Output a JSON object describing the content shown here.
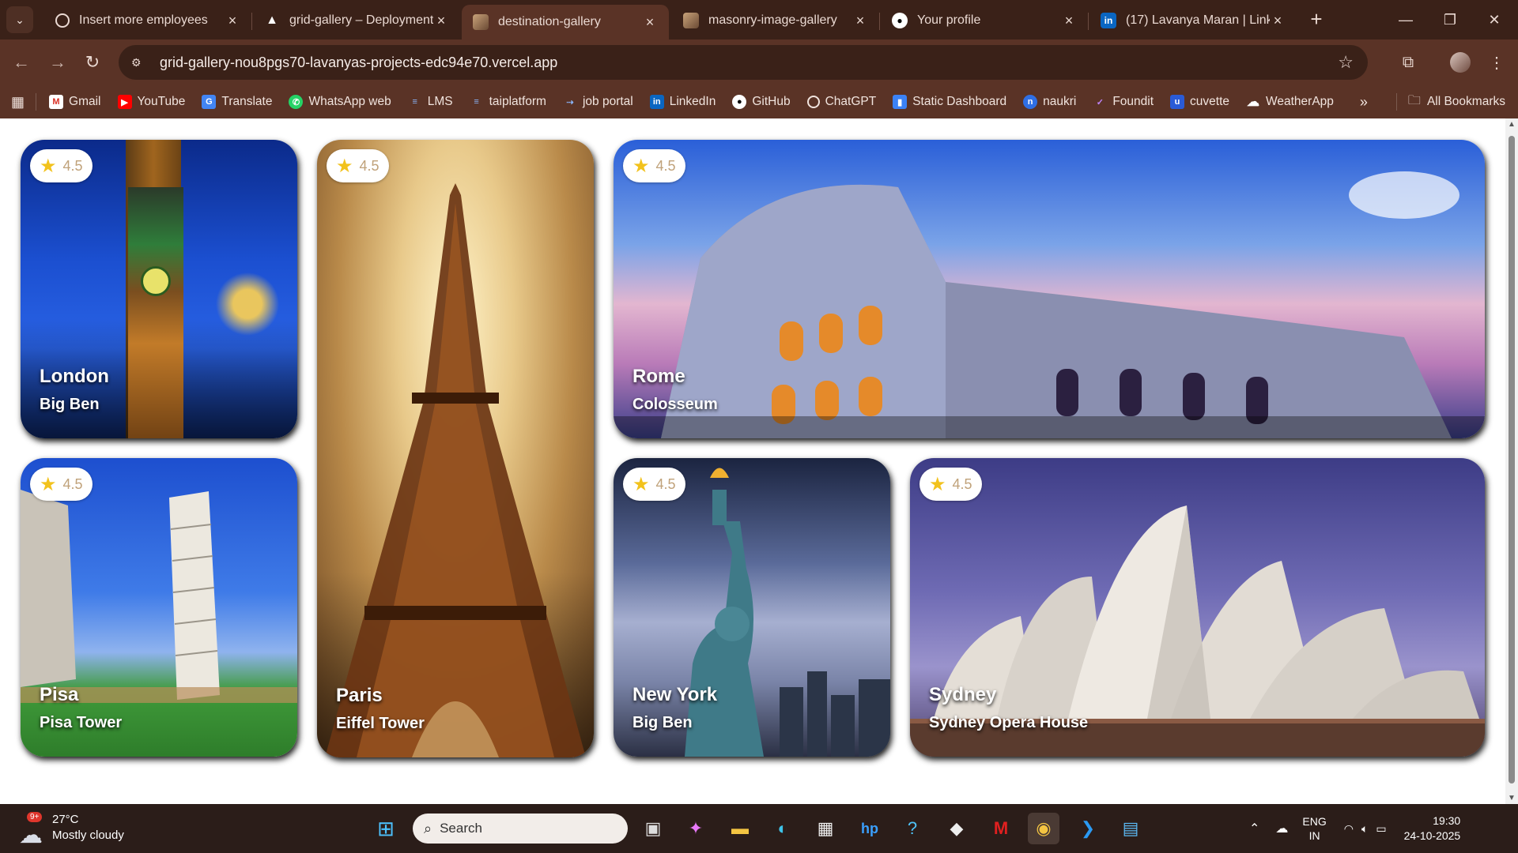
{
  "browser": {
    "tabs": [
      {
        "title": "Insert more employees",
        "icon": "openai-icon"
      },
      {
        "title": "grid-gallery – Deployment",
        "icon": "vercel-icon"
      },
      {
        "title": "destination-gallery",
        "icon": "gallery-icon",
        "active": true
      },
      {
        "title": "masonry-image-gallery",
        "icon": "gallery-icon"
      },
      {
        "title": "Your profile",
        "icon": "github-icon"
      },
      {
        "title": "(17) Lavanya Maran | Linke",
        "icon": "linkedin-icon"
      }
    ],
    "url": "grid-gallery-nou8pgs70-lavanyas-projects-edc94e70.vercel.app",
    "bookmarks": [
      "Gmail",
      "YouTube",
      "Translate",
      "WhatsApp web",
      "LMS",
      "taiplatform",
      "job portal",
      "LinkedIn",
      "GitHub",
      "ChatGPT",
      "Static Dashboard",
      "naukri",
      "Foundit",
      "cuvette",
      "WeatherApp"
    ],
    "more_bookmarks": "»",
    "all_bookmarks": "All Bookmarks"
  },
  "gallery": {
    "cards": [
      {
        "city": "London",
        "place": "Big Ben",
        "rating": "4.5"
      },
      {
        "city": "Paris",
        "place": "Eiffel Tower",
        "rating": "4.5"
      },
      {
        "city": "Rome",
        "place": "Colosseum",
        "rating": "4.5"
      },
      {
        "city": "Pisa",
        "place": "Pisa Tower",
        "rating": "4.5"
      },
      {
        "city": "New York",
        "place": "Big Ben",
        "rating": "4.5"
      },
      {
        "city": "Sydney",
        "place": "Sydney Opera House",
        "rating": "4.5"
      }
    ]
  },
  "taskbar": {
    "weather_badge": "9+",
    "temperature": "27°C",
    "condition": "Mostly cloudy",
    "search_placeholder": "Search",
    "lang_top": "ENG",
    "lang_bottom": "IN",
    "time": "19:30",
    "date": "24-10-2025"
  }
}
